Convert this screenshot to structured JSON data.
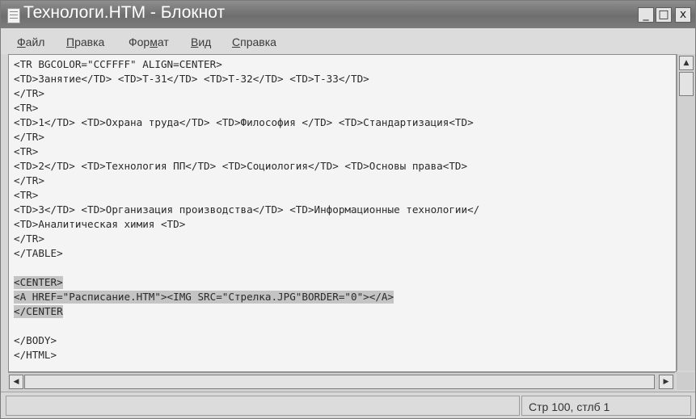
{
  "window": {
    "title": "Технологи.HTM - Блокнот",
    "controls": {
      "minimize": "_",
      "maximize": "□",
      "close": "x"
    }
  },
  "menu": [
    {
      "label": "Файл",
      "accel_char": "Ф",
      "rest": "айл"
    },
    {
      "label": "Правка",
      "accel_char": "П",
      "rest": "равка"
    },
    {
      "label": "Формат",
      "accel_pre": "Фор",
      "accel_char": "м",
      "rest": "ат"
    },
    {
      "label": "Вид",
      "accel_char": "В",
      "rest": "ид"
    },
    {
      "label": "Справка",
      "accel_char": "С",
      "rest": "правка"
    }
  ],
  "editor": {
    "lines": [
      "<TR BGCOLOR=\"CCFFFF\" ALIGN=CENTER>",
      "<TD>Занятие</TD> <TD>Т-31</TD> <TD>Т-32</TD> <TD>Т-33</TD>",
      "</TR>",
      "<TR>",
      "<TD>1</TD> <TD>Охрана труда</TD> <TD>Философия </TD> <TD>Стандартизация<TD>",
      "</TR>",
      "<TR>",
      "<TD>2</TD> <TD>Технология ПП</TD> <TD>Социология</TD> <TD>Основы права<TD>",
      "</TR>",
      "<TR>",
      "<TD>3</TD> <TD>Организация производства</TD> <TD>Информационные технологии</",
      "<TD>Аналитическая химия <TD>",
      "</TR>",
      "</TABLE>",
      "",
      "<CENTER>",
      "<A HREF=\"Расписание.HTM\"><IMG SRC=\"Стрелка.JPG\"BORDER=\"0\"></A>",
      "</CENTER",
      "",
      "</BODY>",
      "</HTML>"
    ],
    "selected_lines": [
      15,
      16,
      17
    ]
  },
  "status": {
    "position": "Стр 100, стлб 1"
  },
  "icons": [
    "notepad-app-icon",
    "minimize-icon",
    "maximize-icon",
    "close-icon",
    "scroll-up-icon",
    "scroll-left-icon",
    "scroll-right-icon"
  ]
}
